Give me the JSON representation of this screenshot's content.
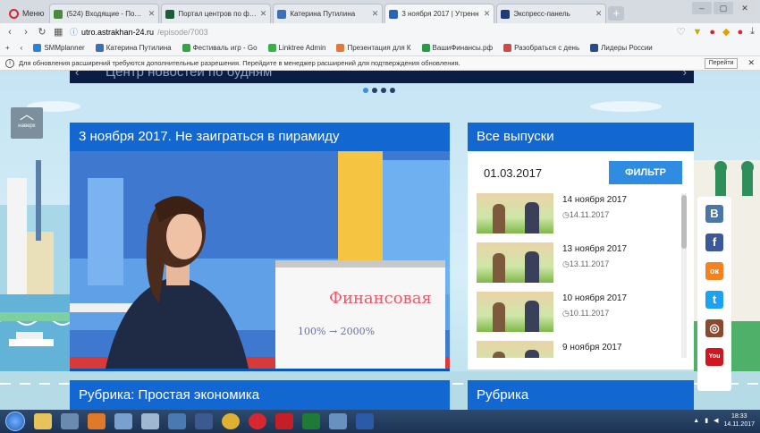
{
  "browser": {
    "menu_label": "Меню",
    "tabs": [
      {
        "title": "(524) Входящие - Почта Ма",
        "color": "#4a8a3a"
      },
      {
        "title": "Портал центров по фина",
        "color": "#1a5e38"
      },
      {
        "title": "Катерина Путилина",
        "color": "#3b6fb6"
      },
      {
        "title": "3 ноября 2017 | Утренн",
        "color": "#2a64b8"
      },
      {
        "title": "Экспресс-панель",
        "color": "#1f3b7a"
      }
    ],
    "new_tab_label": "+",
    "url_host": "utro.astrakhan-24.ru",
    "url_path": "/episode/7003",
    "bookmarks": [
      {
        "label": "SMMplanner",
        "color": "#2c82d8"
      },
      {
        "label": "Катерина Путилина",
        "color": "#3b6fb6"
      },
      {
        "label": "Фестиваль игр - Go",
        "color": "#3aa04a"
      },
      {
        "label": "Linktree Admin",
        "color": "#39b04a"
      },
      {
        "label": "Презентация для К",
        "color": "#e0793a"
      },
      {
        "label": "ВашиФинансы.рф",
        "color": "#2a9a4a"
      },
      {
        "label": "Разобраться с день",
        "color": "#d04a4a"
      },
      {
        "label": "Лидеры России",
        "color": "#2b4a8a"
      }
    ],
    "info_message": "Для обновления расширений требуются дополнительные разрешения. Перейдите в менеджер расширений для подтверждения обновления.",
    "info_button": "Перейти",
    "info_close": "✕"
  },
  "page": {
    "slider_title": "Центр новостей по будням",
    "back_up_label": "наверх",
    "video_title": "3 ноября 2017. Не заиграться в пирамиду",
    "whiteboard_text_1": "Финансовая",
    "whiteboard_text_2": "100% → 2000%",
    "rubric_left": "Рубрика: Простая экономика",
    "rubric_right": "Рубрика",
    "issues": {
      "title": "Все выпуски",
      "date_value": "01.03.2017",
      "filter_button": "ФИЛЬТР",
      "items": [
        {
          "title": "14 ноября 2017",
          "date": "◷14.11.2017"
        },
        {
          "title": "13 ноября 2017",
          "date": "◷13.11.2017"
        },
        {
          "title": "10 ноября 2017",
          "date": "◷10.11.2017"
        },
        {
          "title": "9 ноября 2017",
          "date": ""
        }
      ]
    },
    "social": [
      {
        "name": "vk",
        "glyph": "В",
        "color": "#4a76a8"
      },
      {
        "name": "facebook",
        "glyph": "f",
        "color": "#3b5998"
      },
      {
        "name": "odnoklassniki",
        "glyph": "ок",
        "color": "#f58220"
      },
      {
        "name": "twitter",
        "glyph": "t",
        "color": "#1da1f2"
      },
      {
        "name": "instagram",
        "glyph": "◎",
        "color": "#8a4a2e"
      },
      {
        "name": "youtube",
        "glyph": "You",
        "color": "#cc181e"
      }
    ]
  },
  "taskbar": {
    "time": "18:33",
    "date": "14.11.2017"
  }
}
